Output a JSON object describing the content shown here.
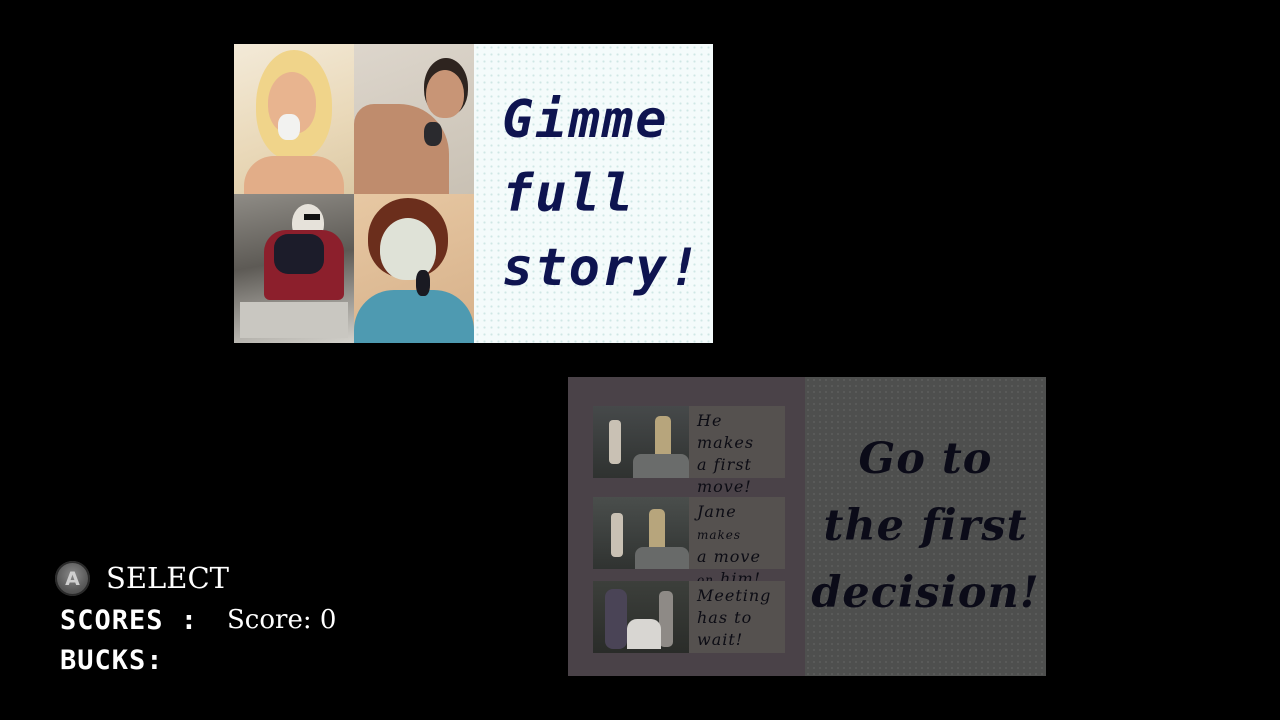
{
  "top_panel": {
    "photos": [
      {
        "subject": "blonde woman on phone"
      },
      {
        "subject": "shirtless man on phone"
      },
      {
        "subject": "woman in sunglasses on phone"
      },
      {
        "subject": "woman with face mask on phone"
      }
    ],
    "title_lines": [
      "Gimme",
      "full",
      "story!"
    ]
  },
  "bottom_panel": {
    "choices": [
      {
        "line1": "He makes",
        "line2": "a first",
        "line3": "move!"
      },
      {
        "line1": "Jane",
        "line1_small": "makes",
        "line2": "a move",
        "line3_small": "on",
        "line3": "him!"
      },
      {
        "line1": "Meeting",
        "line2": "has to",
        "line3": "wait!"
      }
    ],
    "decision_lines": [
      "Go to",
      "the first",
      "decision!"
    ]
  },
  "hud": {
    "button_glyph": "A",
    "select_label": "SELECT",
    "scores_label": "SCORES :",
    "scores_value": "Score: 0",
    "bucks_label": "BUCKS:"
  },
  "colors": {
    "title_text": "#0e1450",
    "title_bg": "#f4fbfb",
    "choices_bg": "#4a4248",
    "decision_bg": "#4e4f4e"
  }
}
